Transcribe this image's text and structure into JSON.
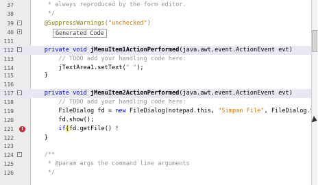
{
  "lines": [
    {
      "num": "37",
      "segments": [
        {
          "t": "     * ",
          "c": "cm"
        },
        {
          "t": "always reproduced by the form editor.",
          "c": "cm"
        }
      ]
    },
    {
      "num": "38",
      "segments": [
        {
          "t": "     */",
          "c": "cm"
        }
      ]
    },
    {
      "num": "39",
      "segments": [
        {
          "t": "    @SuppressWarnings(",
          "c": "an"
        },
        {
          "t": "\"unchecked\"",
          "c": "st"
        },
        {
          "t": ")",
          "c": "an"
        }
      ]
    },
    {
      "num": "40",
      "folded_label": "Generated Code"
    },
    {
      "num": "111",
      "segments": []
    },
    {
      "num": "112",
      "segments": [
        {
          "t": "    ",
          "c": ""
        },
        {
          "t": "private void ",
          "c": "kw"
        },
        {
          "t": "jMenuItem1ActionPerformed",
          "c": "mi"
        },
        {
          "t": "(java.awt.event.ActionEvent evt)",
          "c": ""
        }
      ]
    },
    {
      "num": "113",
      "segments": [
        {
          "t": "        // TODO add your handling code here:",
          "c": "cm"
        }
      ]
    },
    {
      "num": "114",
      "segments": [
        {
          "t": "        jTextArea1.setText(",
          "c": ""
        },
        {
          "t": "\" \"",
          "c": "st"
        },
        {
          "t": ");",
          "c": ""
        }
      ]
    },
    {
      "num": "115",
      "segments": [
        {
          "t": "    }",
          "c": ""
        }
      ]
    },
    {
      "num": "116",
      "segments": []
    },
    {
      "num": "117",
      "segments": [
        {
          "t": "    ",
          "c": ""
        },
        {
          "t": "private void ",
          "c": "kw"
        },
        {
          "t": "jMenuItem2ActionPerformed",
          "c": "mi"
        },
        {
          "t": "(java.awt.event.ActionEvent evt)",
          "c": ""
        }
      ]
    },
    {
      "num": "118",
      "segments": [
        {
          "t": "        // TODO add your handling code here:",
          "c": "cm"
        }
      ]
    },
    {
      "num": "119",
      "segments": [
        {
          "t": "        FileDialog fd = ",
          "c": ""
        },
        {
          "t": "new ",
          "c": "kw"
        },
        {
          "t": "FileDialog(notepad.this, ",
          "c": ""
        },
        {
          "t": "\"Simpan File\"",
          "c": "st"
        },
        {
          "t": ", FileDialog.SAVE);",
          "c": ""
        }
      ]
    },
    {
      "num": "120",
      "segments": [
        {
          "t": "        fd.",
          "c": ""
        },
        {
          "t": "show",
          "c": "fn"
        },
        {
          "t": "();",
          "c": ""
        }
      ]
    },
    {
      "num": "121",
      "segments": [
        {
          "t": "        ",
          "c": ""
        },
        {
          "t": "if",
          "c": "kw"
        },
        {
          "t": "(",
          "c": "brk"
        },
        {
          "t": "fd.getFile() ",
          "c": ""
        },
        {
          "t": "!",
          "c": ""
        }
      ]
    },
    {
      "num": "122",
      "segments": [
        {
          "t": "    }",
          "c": ""
        }
      ]
    },
    {
      "num": "123",
      "segments": []
    },
    {
      "num": "124",
      "segments": [
        {
          "t": "    /**",
          "c": "cm"
        }
      ]
    },
    {
      "num": "125",
      "segments": [
        {
          "t": "     * @param args the command line arguments",
          "c": "cm"
        }
      ]
    },
    {
      "num": "126",
      "segments": [
        {
          "t": "     */",
          "c": "cm"
        }
      ]
    }
  ]
}
